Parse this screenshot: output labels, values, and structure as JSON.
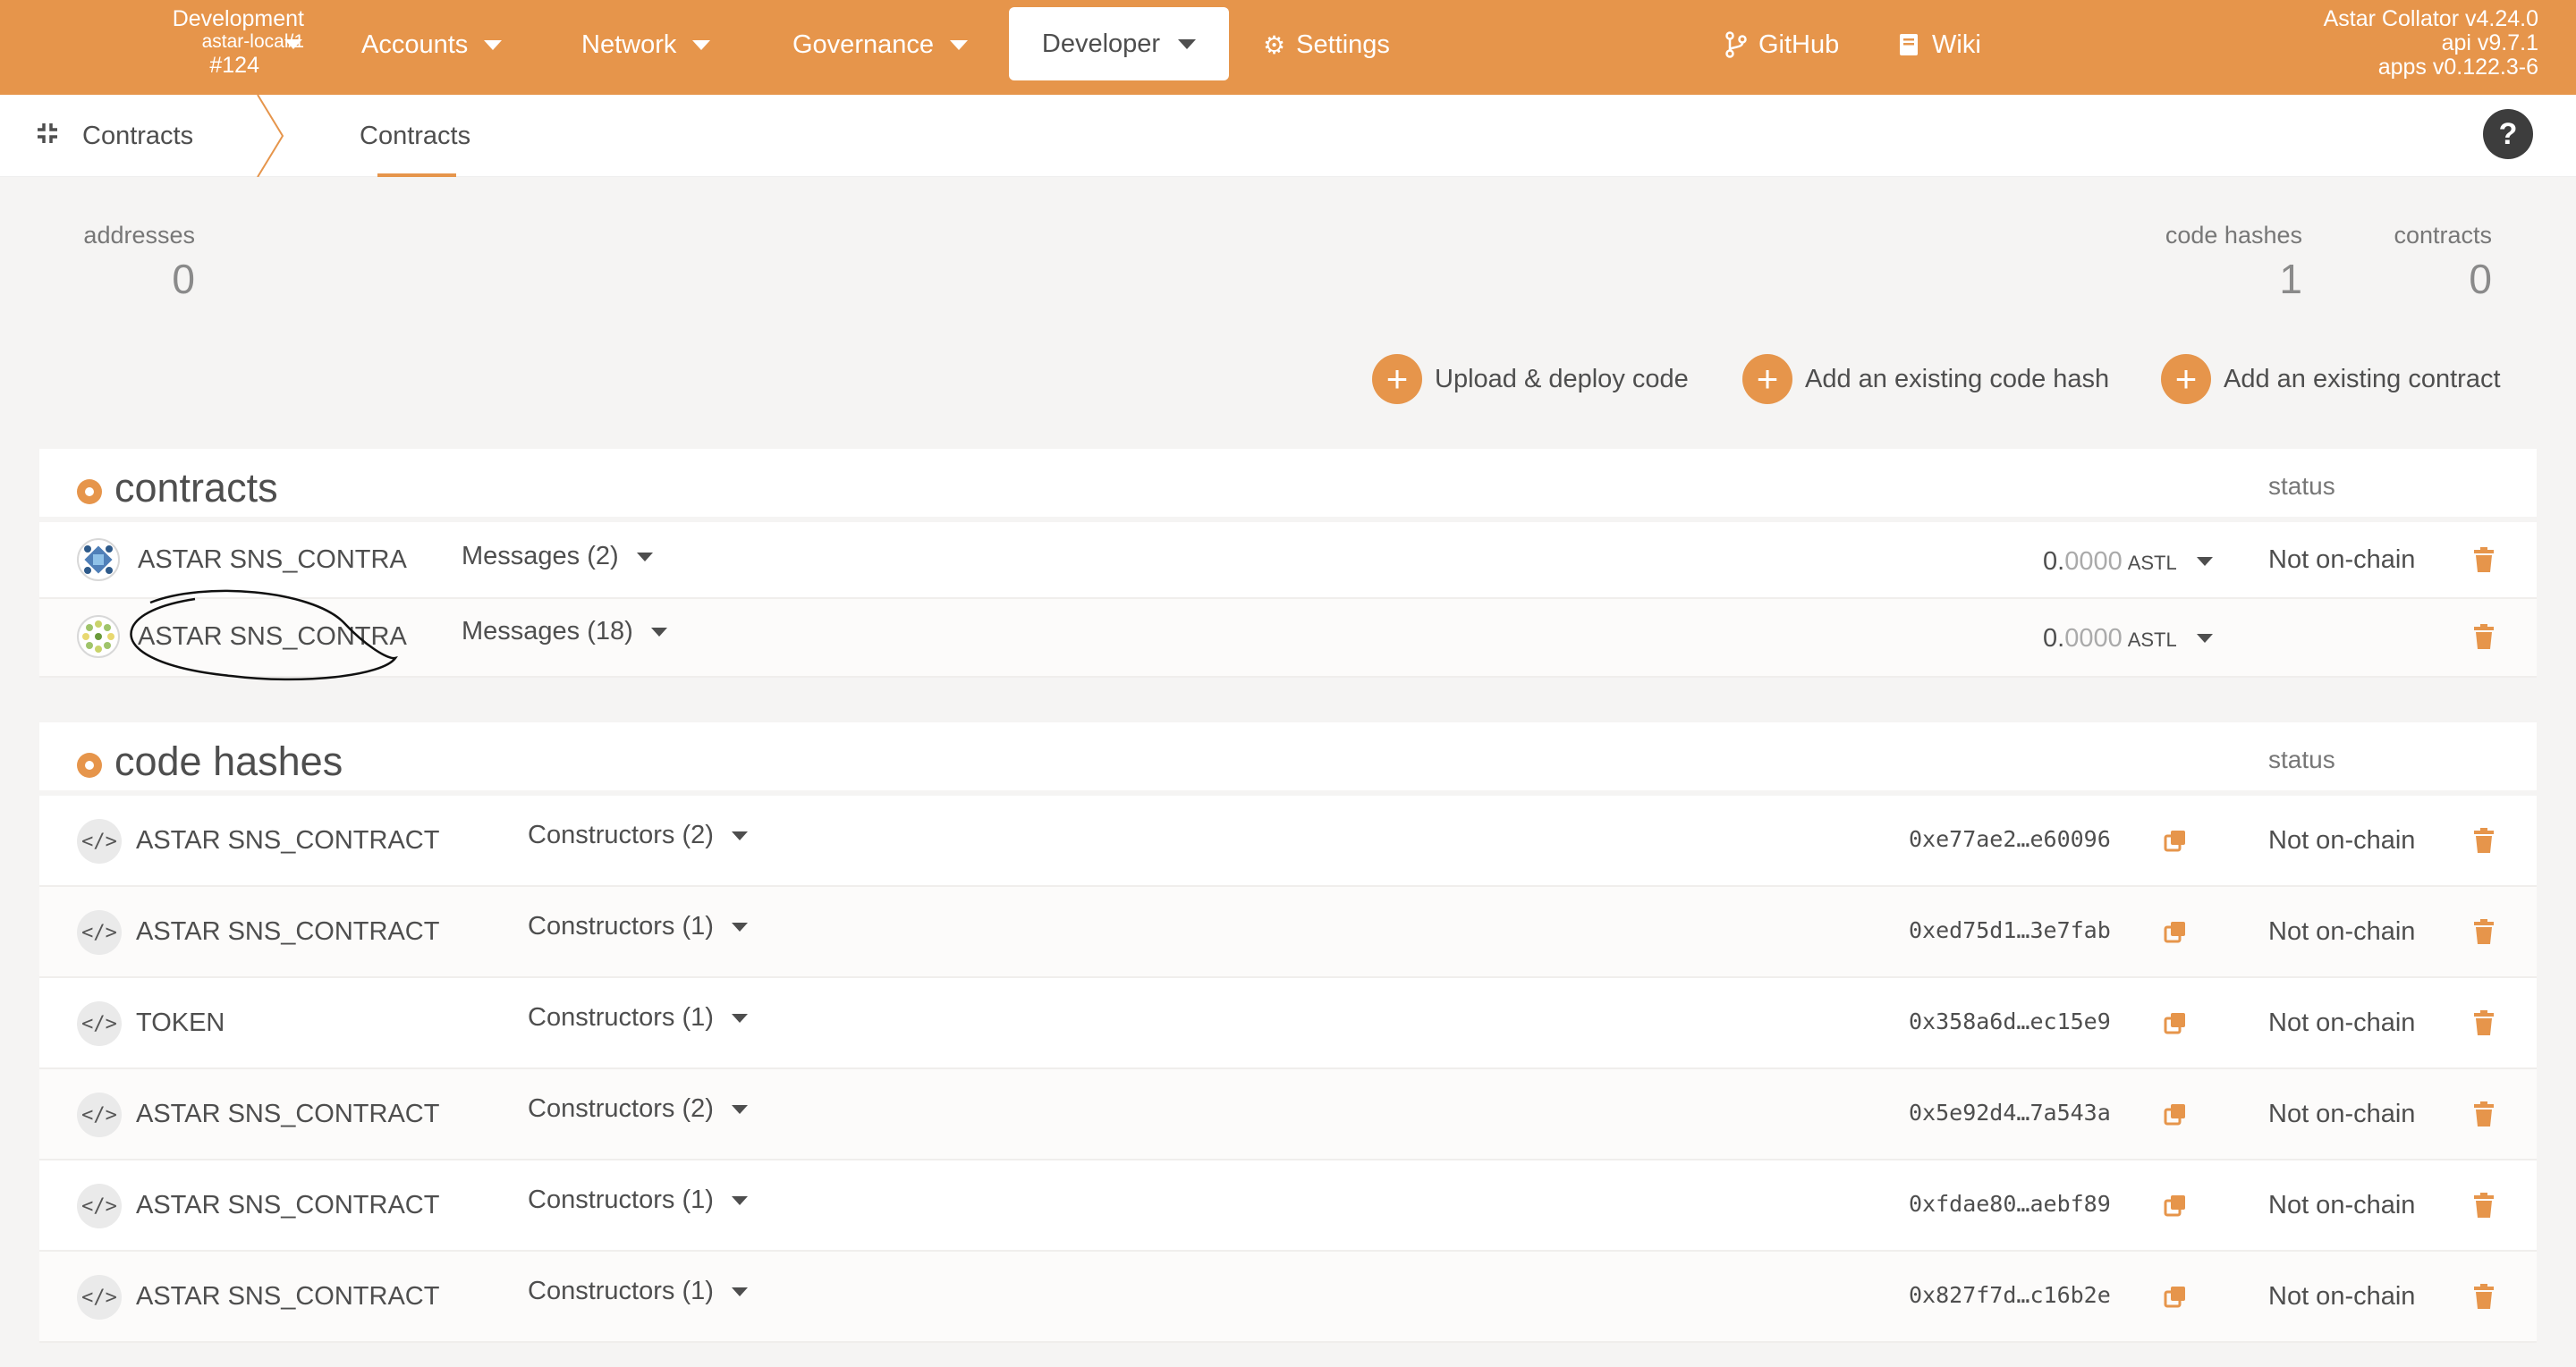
{
  "topbar": {
    "chain_name": "Development",
    "chain_node": "astar-local/1",
    "chain_block": "#124",
    "menu": [
      {
        "label": "Accounts"
      },
      {
        "label": "Network"
      },
      {
        "label": "Governance"
      },
      {
        "label": "Developer"
      },
      {
        "label": "Settings"
      },
      {
        "label": "GitHub"
      },
      {
        "label": "Wiki"
      }
    ],
    "version": [
      "Astar Collator v4.24.0",
      "api v9.7.1",
      "apps v0.122.3-6"
    ]
  },
  "subbar": {
    "section": "Contracts",
    "tab": "Contracts",
    "help": "?"
  },
  "summary": {
    "addresses_label": "addresses",
    "addresses_value": "0",
    "code_hashes_label": "code hashes",
    "code_hashes_value": "1",
    "contracts_label": "contracts",
    "contracts_value": "0"
  },
  "actions": {
    "upload": "Upload & deploy code",
    "add_hash": "Add an existing code hash",
    "add_contract": "Add an existing contract"
  },
  "contracts": {
    "title": "contracts",
    "status_header": "status",
    "rows": [
      {
        "name": "ASTAR SNS_CONTRA",
        "messages": "Messages (2)",
        "balance_int": "0.",
        "balance_frac": "0000",
        "unit": "ASTL",
        "status": "Not on-chain"
      },
      {
        "name": "ASTAR SNS_CONTRA",
        "messages": "Messages (18)",
        "balance_int": "0.",
        "balance_frac": "0000",
        "unit": "ASTL",
        "status": ""
      }
    ]
  },
  "code_hashes": {
    "title": "code hashes",
    "status_header": "status",
    "rows": [
      {
        "name": "ASTAR SNS_CONTRACT",
        "constructors": "Constructors (2)",
        "hash": "0xe77ae2…e60096",
        "status": "Not on-chain"
      },
      {
        "name": "ASTAR SNS_CONTRACT",
        "constructors": "Constructors (1)",
        "hash": "0xed75d1…3e7fab",
        "status": "Not on-chain"
      },
      {
        "name": "TOKEN",
        "constructors": "Constructors (1)",
        "hash": "0x358a6d…ec15e9",
        "status": "Not on-chain"
      },
      {
        "name": "ASTAR SNS_CONTRACT",
        "constructors": "Constructors (2)",
        "hash": "0x5e92d4…7a543a",
        "status": "Not on-chain"
      },
      {
        "name": "ASTAR SNS_CONTRACT",
        "constructors": "Constructors (1)",
        "hash": "0xfdae80…aebf89",
        "status": "Not on-chain"
      },
      {
        "name": "ASTAR SNS_CONTRACT",
        "constructors": "Constructors (1)",
        "hash": "0x827f7d…c16b2e",
        "status": "Not on-chain"
      }
    ]
  },
  "colors": {
    "accent": "#e6954b",
    "text": "#4e4e4e",
    "background": "#f5f4f3"
  },
  "icons": [
    "chevron-down-icon",
    "gears-icon",
    "git-branch-icon",
    "book-icon",
    "compress-icon",
    "help-icon",
    "plus-icon",
    "code-icon",
    "copy-icon",
    "trash-icon"
  ]
}
